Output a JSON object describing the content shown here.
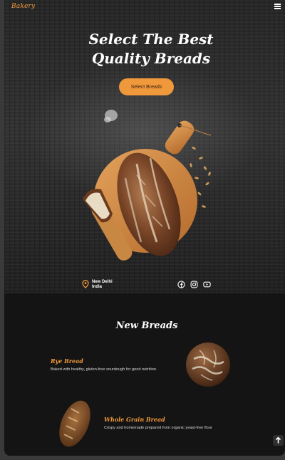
{
  "navbar": {
    "logo": "Bakery",
    "menu_icon": "hamburger-menu-icon"
  },
  "hero": {
    "title_line1": "Select The Best",
    "title_line2": "Quality Breads",
    "cta_label": "Select Breads",
    "location_line1": "New Delhi",
    "location_line2": "India",
    "location_icon": "location-pin-icon",
    "socials": [
      "facebook-icon",
      "instagram-icon",
      "youtube-icon"
    ]
  },
  "new_breads": {
    "title": "New Breads",
    "items": [
      {
        "name": "Rye Bread",
        "description": "Baked with healthy, gluten-free sourdough for good nutrition."
      },
      {
        "name": "Whole Grain Bread",
        "description": "Crispy and homemade prepared from organic yeast-free flour"
      }
    ]
  },
  "scroll_top_icon": "arrow-up-icon",
  "colors": {
    "accent": "#f0983c",
    "background": "#141414",
    "text": "#ffffff"
  }
}
